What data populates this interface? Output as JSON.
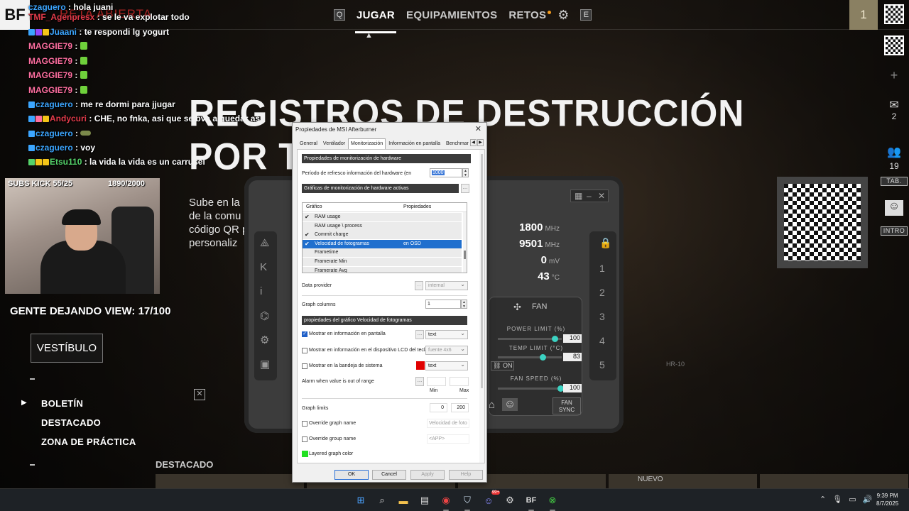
{
  "topbar": {
    "logo": "BF",
    "ghost_title": "RETA ABIERTA",
    "key_left": "Q",
    "key_right": "E",
    "nav": [
      {
        "label": "JUGAR",
        "active": true
      },
      {
        "label": "EQUIPAMIENTOS",
        "active": false
      },
      {
        "label": "RETOS",
        "active": false
      }
    ],
    "level": "1"
  },
  "right_sidebar": {
    "plus": "+",
    "mail_count": "2",
    "friends_count": "19",
    "tab_label": "TAB.",
    "intro_label": "INTRO"
  },
  "chat": [
    {
      "user": "czaguero",
      "message": "hola juani",
      "color": "blue",
      "badges": []
    },
    {
      "user": "TMF_Agenpresx",
      "message": "se le va explotar todo",
      "color": "red",
      "badges": []
    },
    {
      "user": "Juaani",
      "message": "te respondi lg yogurt",
      "color": "blue",
      "badges": [
        "#3ca6ff",
        "#9147ff",
        "#f5c518"
      ]
    },
    {
      "user": "MAGGIE79",
      "message": "",
      "color": "pink",
      "badges": [],
      "emote": "green"
    },
    {
      "user": "MAGGIE79",
      "message": "",
      "color": "pink",
      "badges": [],
      "emote": "green"
    },
    {
      "user": "MAGGIE79",
      "message": "",
      "color": "pink",
      "badges": [],
      "emote": "green"
    },
    {
      "user": "MAGGIE79",
      "message": "",
      "color": "pink",
      "badges": [],
      "emote": "green"
    },
    {
      "user": "czaguero",
      "message": "me re dormi para jjugar",
      "color": "blue",
      "badges": [
        "#3ca6ff"
      ]
    },
    {
      "user": "Andycuri",
      "message": "CHE, no fnka, asi que se bva a quedar asi",
      "color": "red",
      "badges": [
        "#3ca6ff",
        "#ff6fa0",
        "#f5c518"
      ]
    },
    {
      "user": "czaguero",
      "message": "",
      "color": "blue",
      "badges": [
        "#3ca6ff"
      ],
      "emote": "truck"
    },
    {
      "user": "czaguero",
      "message": "voy",
      "color": "blue",
      "badges": [
        "#3ca6ff"
      ]
    },
    {
      "user": "Etsu110",
      "message": "la vida la vida es un carrusel",
      "color": "green",
      "badges": [
        "#55d36a",
        "#f5c518",
        "#f5c518"
      ]
    }
  ],
  "stream": {
    "subs": "SUBS KICK 55/25",
    "goal": "1890/2000",
    "leave": "GENTE DEJANDO VIEW: 17/100"
  },
  "game_menu": {
    "hero_line1": "REGISTROS DE DESTRUCCIÓN",
    "hero_line2": "POR TIE",
    "sub_lines": [
      "Sube en la",
      "de la comu",
      "código QR p",
      "personaliz"
    ],
    "lobby_button": "VESTÍBULO",
    "items": [
      "BOLETÍN",
      "DESTACADO",
      "ZONA DE PRÁCTICA"
    ],
    "featured": "DESTACADO",
    "new_tag": "NUEVO"
  },
  "afterburner": {
    "readouts": [
      {
        "value": "1800",
        "unit": "MHz"
      },
      {
        "value": "9501",
        "unit": "MHz"
      },
      {
        "value": "0",
        "unit": "mV"
      },
      {
        "value": "43",
        "unit": "°C"
      }
    ],
    "left_icons": [
      "K",
      "i"
    ],
    "profiles": [
      "1",
      "2",
      "3",
      "4",
      "5"
    ],
    "fan": "FAN",
    "power_limit_label": "POWER LIMIT (%)",
    "power_limit": "100",
    "power_limit_fraction": 0.9,
    "temp_limit_label": "TEMP LIMIT (°C)",
    "temp_limit": "83",
    "temp_limit_fraction": 0.7,
    "on_label": "ON",
    "fan_speed_label": "FAN SPEED (%)",
    "fan_speed": "100",
    "fan_speed_fraction": 1.0,
    "fan_sync": "FAN SYNC",
    "card_label": "HR-10"
  },
  "dialog": {
    "title": "Propiedades de MSI Afterburner",
    "tabs": [
      {
        "label": "General",
        "active": false
      },
      {
        "label": "Ventilador",
        "active": false
      },
      {
        "label": "Monitorización",
        "active": true
      },
      {
        "label": "Información en pantalla",
        "active": false
      },
      {
        "label": "Benchmar",
        "active": false
      }
    ],
    "section_hw": "Propiedades de monitorización de hardware",
    "refresh_label": "Período de refresco información del hardware (en",
    "refresh_value": "1000",
    "section_graphs": "Gráficas de monitorización de hardware activas",
    "list_headers": [
      "Gráfico",
      "Propiedades"
    ],
    "list_rows": [
      {
        "name": "RAM usage",
        "checked": true,
        "props": "",
        "selected": false
      },
      {
        "name": "RAM usage \\ process",
        "checked": false,
        "props": "",
        "selected": false
      },
      {
        "name": "Commit charge",
        "checked": true,
        "props": "",
        "selected": false
      },
      {
        "name": "Velocidad de fotogramas",
        "checked": true,
        "props": "en OSD",
        "selected": true
      },
      {
        "name": "Frametime",
        "checked": false,
        "props": "",
        "selected": false
      },
      {
        "name": "Framerate Min",
        "checked": false,
        "props": "",
        "selected": false
      },
      {
        "name": "Framerate Avg",
        "checked": false,
        "props": "",
        "selected": false
      }
    ],
    "data_provider_label": "Data provider",
    "data_provider_value": "internal",
    "graph_columns_label": "Graph columns",
    "graph_columns_value": "1",
    "section_graph_props": "propiedades del gráfico Velocidad de fotogramas",
    "osd_label": "Mostrar en información en pantalla",
    "osd_checked": true,
    "osd_value": "text",
    "lcd_label": "Mostrar en información en el dispositivo LCD del teclad",
    "lcd_checked": false,
    "lcd_value": "fuente 4x6",
    "tray_label": "Mostrar en la bandeja de sistema",
    "tray_checked": false,
    "tray_value": "text",
    "tray_color": "#e00000",
    "alarm_label": "Alarm when value is out of range",
    "min_label": "Min",
    "max_label": "Max",
    "graph_limits_label": "Graph limits",
    "graph_limit_min": "0",
    "graph_limit_max": "200",
    "override_graph_label": "Override graph name",
    "override_graph_value": "Velocidad de foto",
    "override_group_label": "Override group name",
    "override_group_value": "<APP>",
    "layered_label": "Layered graph color",
    "layered_color": "#22e022",
    "buttons": {
      "ok": "OK",
      "cancel": "Cancel",
      "apply": "Apply",
      "help": "Help"
    }
  },
  "taskbar": {
    "time": "9:39 PM",
    "date": "8/7/2025",
    "badge": "99+"
  }
}
